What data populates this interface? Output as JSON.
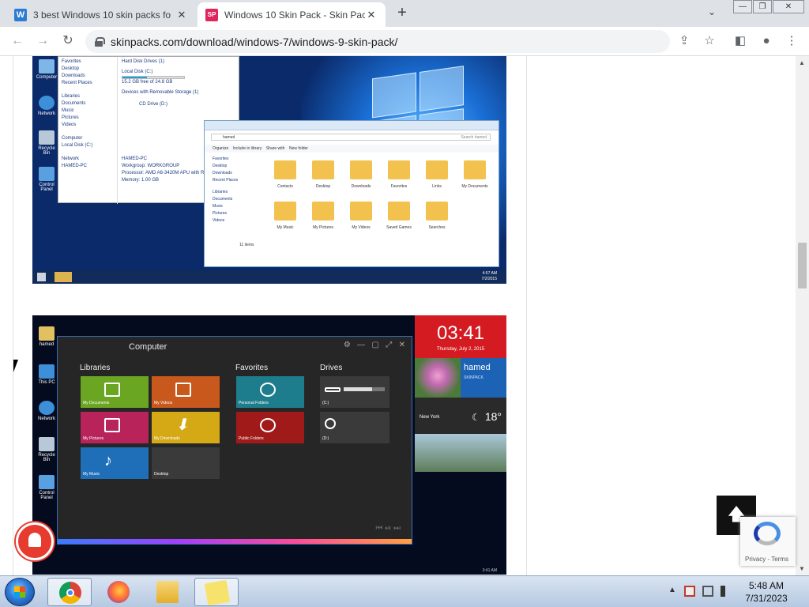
{
  "browser": {
    "tabs": [
      {
        "title": "3 best Windows 10 skin packs fo",
        "favicon": "W",
        "favicon_color": "#2b7cd3",
        "active": false
      },
      {
        "title": "Windows 10 Skin Pack - Skin Pac",
        "favicon": "SP",
        "favicon_color": "#e0245e",
        "active": true
      }
    ],
    "new_tab": "+",
    "close_glyph": "✕",
    "url": "skinpacks.com/download/windows-7/windows-9-skin-pack/"
  },
  "page": {
    "screenshot1": {
      "desktop_icons": [
        "Computer",
        "Network",
        "Recycle Bin",
        "Control Panel"
      ],
      "explorer": {
        "nav": [
          "Favorites",
          "Desktop",
          "Downloads",
          "Recent Places",
          "Libraries",
          "Documents",
          "Music",
          "Pictures",
          "Videos",
          "Computer",
          "Local Disk (C:)",
          "Network",
          "HAMED-PC"
        ],
        "section_drives": "Hard Disk Drives (1)",
        "drive": "Local Disk (C:)",
        "drive_free": "15.2 GB free of 24.8 GB",
        "section_removable": "Devices with Removable Storage (1)",
        "cd": "CD Drive (D:)",
        "pc_name": "HAMED-PC",
        "workgroup": "Workgroup: WORKGROUP",
        "processor": "Processor: AMD A6-3420M APU with Radeon",
        "memory": "Memory: 1.00 GB"
      },
      "explorer2": {
        "address": "hamed",
        "search": "Search hamed",
        "commands": [
          "Organize",
          "Include in library",
          "Share with",
          "New folder"
        ],
        "nav": [
          "Favorites",
          "Desktop",
          "Downloads",
          "Recent Places",
          "Libraries",
          "Documents",
          "Music",
          "Pictures",
          "Videos"
        ],
        "folders": [
          "Contacts",
          "Desktop",
          "Downloads",
          "Favorites",
          "Links",
          "My Documents",
          "My Music",
          "My Pictures",
          "My Videos",
          "Saved Games",
          "Searches"
        ],
        "items": "11 items"
      },
      "clock": "4:57 AM",
      "date": "7/2/2015"
    },
    "screenshot2": {
      "desktop_icons": [
        "hamed",
        "This PC",
        "Network",
        "Recycle Bin",
        "Control Panel"
      ],
      "window_title": "Computer",
      "libraries_label": "Libraries",
      "favorites_label": "Favorites",
      "drives_label": "Drives",
      "library_tiles": [
        {
          "label": "My Documents",
          "color": "#6aa621"
        },
        {
          "label": "My Videos",
          "color": "#c8581c"
        },
        {
          "label": "My Pictures",
          "color": "#b8245a"
        },
        {
          "label": "My Downloads",
          "color": "#d5a916"
        },
        {
          "label": "My Music",
          "color": "#1e6fb8"
        },
        {
          "label": "Desktop",
          "color": "#3a3a3a"
        }
      ],
      "favorite_tiles": [
        {
          "label": "Personal Folders",
          "color": "#1e7d8c"
        },
        {
          "label": "Public Folders",
          "color": "#a01a1a"
        }
      ],
      "drive_tiles": [
        {
          "label": "(C:)",
          "color": "#3a3a3a"
        },
        {
          "label": "(D:)",
          "color": "#3a3a3a"
        }
      ],
      "widget_time": "03:41",
      "widget_date": "Thursday, July 2, 2015",
      "user_name": "hamed",
      "user_sub": "SKINPACK",
      "weather_city": "New York",
      "weather_temp": "18°",
      "taskbar_time": "3:41 AM"
    }
  },
  "scroll_top_glyph": "🡅",
  "recaptcha": {
    "text": "Privacy - Terms"
  },
  "taskbar": {
    "time": "5:48 AM",
    "date": "7/31/2023",
    "tray_arrow": "▲"
  }
}
